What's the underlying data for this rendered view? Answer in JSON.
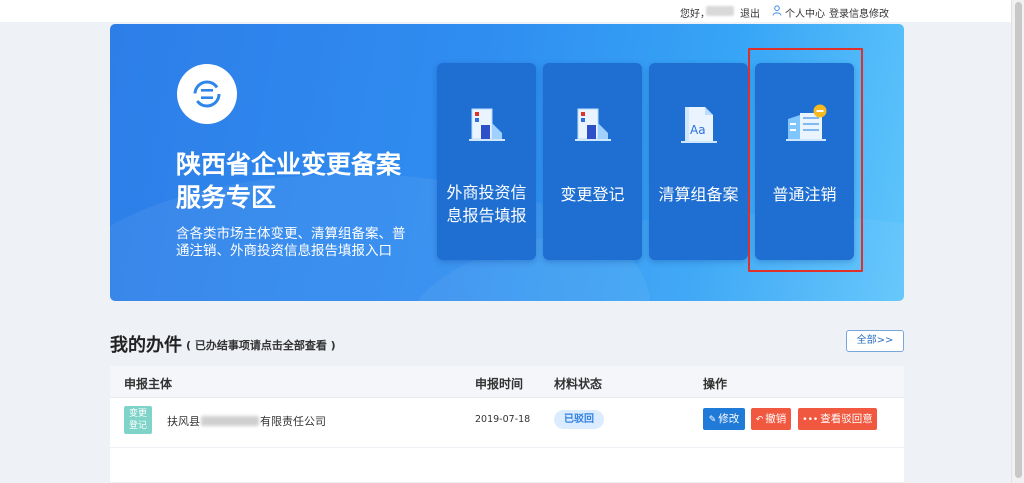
{
  "topbar": {
    "greeting": "您好，",
    "logout": "退出",
    "personal_center": "个人中心",
    "login_info_modify": "登录信息修改"
  },
  "banner": {
    "title_line1": "陕西省企业变更备案",
    "title_line2": "服务专区",
    "subtitle_line1": "含各类市场主体变更、清算组备案、普",
    "subtitle_line2": "通注销、外商投资信息报告填报入口",
    "cards": [
      {
        "label_line1": "外商投资信",
        "label_line2": "息报告填报",
        "icon": "building-icon"
      },
      {
        "label": "变更登记",
        "icon": "building-icon"
      },
      {
        "label": "清算组备案",
        "icon": "document-aa-icon"
      },
      {
        "label": "普通注销",
        "icon": "building-minus-icon"
      }
    ],
    "colors": {
      "gradient_start": "#2e7ee8",
      "gradient_end": "#5fc5fb",
      "card": "#1f6fd2",
      "highlight": "#e0302a"
    }
  },
  "my_items": {
    "title": "我的办件",
    "hint": "( 已办结事项请点击全部查看 )",
    "all_button": "全部>>"
  },
  "table": {
    "headers": [
      "申报主体",
      "申报时间",
      "材料状态",
      "操作"
    ],
    "rows": [
      {
        "tag_line1": "变更",
        "tag_line2": "登记",
        "company_prefix": "扶风县",
        "company_suffix": "有限责任公司",
        "date": "2019-07-18",
        "status": "已驳回",
        "actions": {
          "edit": "修改",
          "revoke": "撤销",
          "view_opinion": "查看驳回意见"
        }
      }
    ]
  }
}
